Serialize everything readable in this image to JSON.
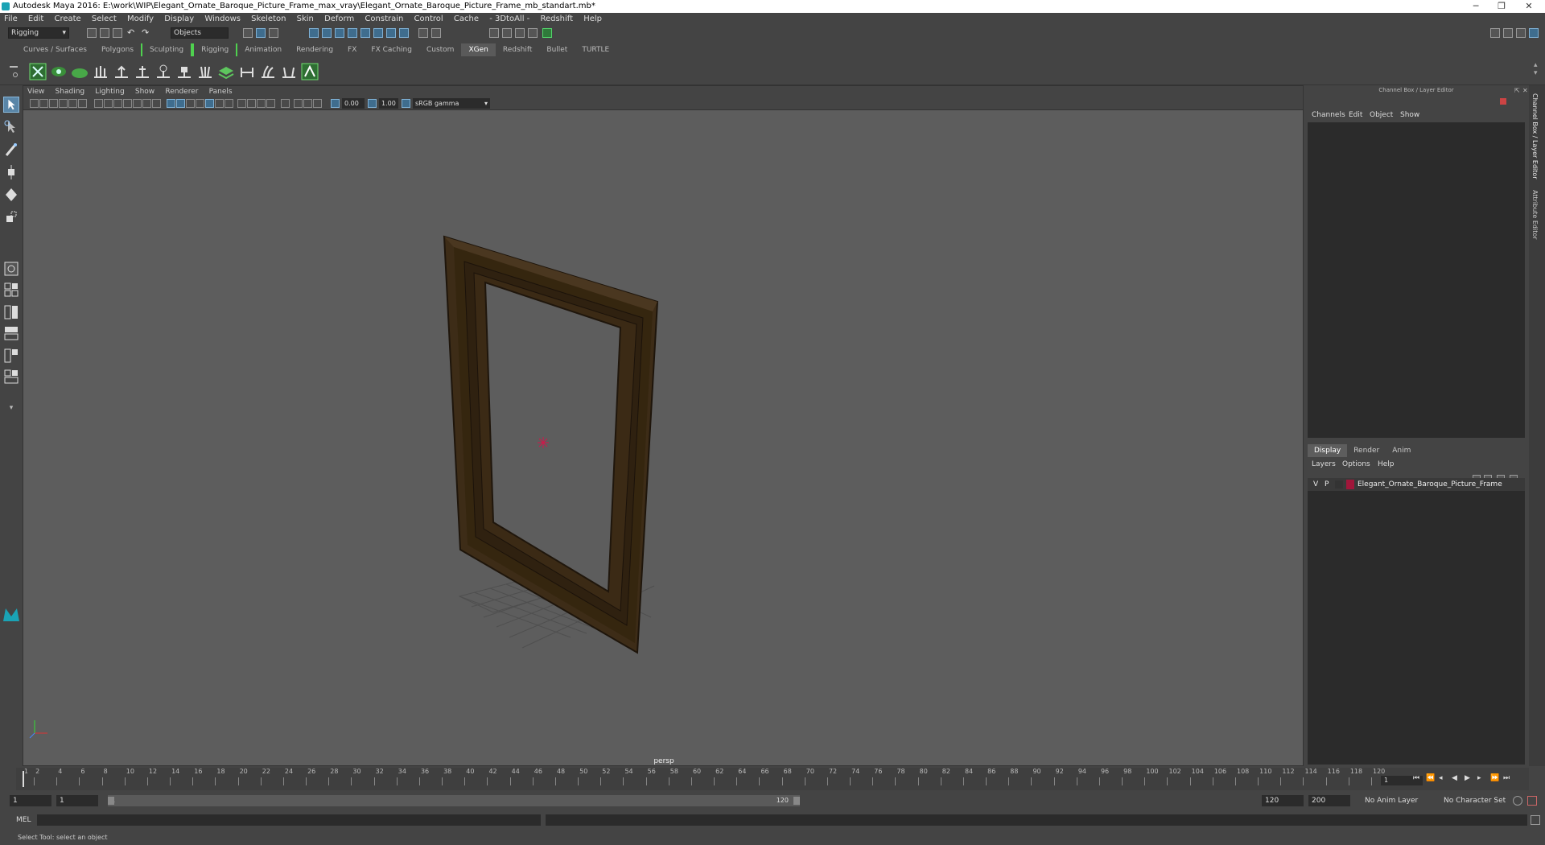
{
  "window": {
    "title": "Autodesk Maya 2016: E:\\work\\WIP\\Elegant_Ornate_Baroque_Picture_Frame_max_vray\\Elegant_Ornate_Baroque_Picture_Frame_mb_standart.mb*",
    "minimize": "─",
    "restore": "❐",
    "close": "✕"
  },
  "menubar": [
    "File",
    "Edit",
    "Create",
    "Select",
    "Modify",
    "Display",
    "Windows",
    "Skeleton",
    "Skin",
    "Deform",
    "Constrain",
    "Control",
    "Cache",
    "- 3DtoAll -",
    "Redshift",
    "Help"
  ],
  "statusline": {
    "menuset": "Rigging",
    "selection_mode": "Objects"
  },
  "shelf_tabs": [
    "Curves / Surfaces",
    "Polygons",
    "Sculpting",
    "Rigging",
    "Animation",
    "Rendering",
    "FX",
    "FX Caching",
    "Custom",
    "XGen",
    "Redshift",
    "Bullet",
    "TURTLE"
  ],
  "shelf_active": "XGen",
  "viewport": {
    "menu": [
      "View",
      "Shading",
      "Lighting",
      "Show",
      "Renderer",
      "Panels"
    ],
    "exposure": "0.00",
    "gamma": "1.00",
    "color_space": "sRGB gamma",
    "camera_label": "persp"
  },
  "channel_box": {
    "header": "Channel Box / Layer Editor",
    "menu": [
      "Channels",
      "Edit",
      "Object",
      "Show"
    ]
  },
  "layer_editor": {
    "tabs": [
      "Display",
      "Render",
      "Anim"
    ],
    "active_tab": "Display",
    "menu": [
      "Layers",
      "Options",
      "Help"
    ],
    "layers": [
      {
        "visible": "V",
        "playback": "P",
        "name": "Elegant_Ornate_Baroque_Picture_Frame",
        "color": "#a0163a"
      }
    ]
  },
  "side_tabs": [
    "Channel Box / Layer Editor",
    "Attribute Editor"
  ],
  "timeline": {
    "ticks": [
      "1",
      "2",
      "4",
      "6",
      "8",
      "10",
      "12",
      "14",
      "16",
      "18",
      "20",
      "22",
      "24",
      "26",
      "28",
      "30",
      "32",
      "34",
      "36",
      "38",
      "40",
      "42",
      "44",
      "46",
      "48",
      "50",
      "52",
      "54",
      "56",
      "58",
      "60",
      "62",
      "64",
      "66",
      "68",
      "70",
      "72",
      "74",
      "76",
      "78",
      "80",
      "82",
      "84",
      "86",
      "88",
      "90",
      "92",
      "94",
      "96",
      "98",
      "100",
      "102",
      "104",
      "106",
      "108",
      "110",
      "112",
      "114",
      "116",
      "118",
      "120"
    ],
    "current_frame": "1"
  },
  "range": {
    "start": "1",
    "playback_start": "1",
    "range_start_label": "1",
    "range_end_label": "120",
    "playback_end": "120",
    "end": "200",
    "anim_layer": "No Anim Layer",
    "character_set": "No Character Set"
  },
  "cmdline": {
    "label": "MEL"
  },
  "helpline": "Select Tool: select an object",
  "colors": {
    "frame_wood": "#3d2c17",
    "frame_wood_light": "#4a3720",
    "viewport_bg": "#5d5d5d",
    "accent": "#5a86a8"
  }
}
